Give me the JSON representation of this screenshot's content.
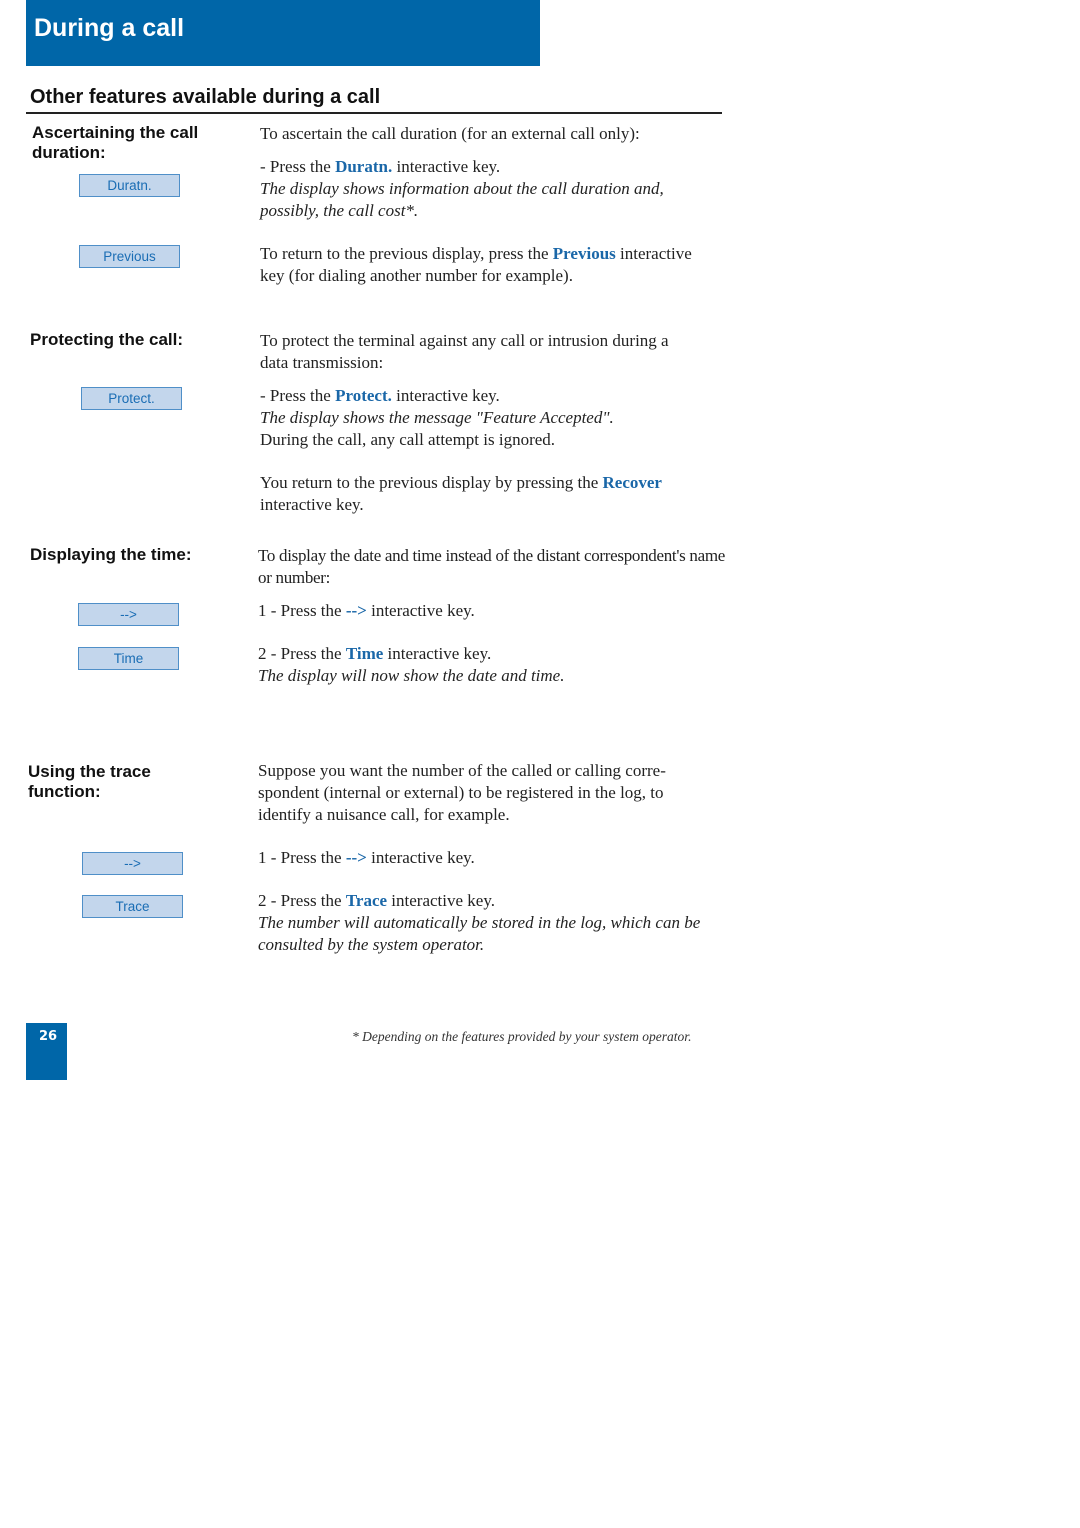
{
  "header": {
    "title": "During a call"
  },
  "section": {
    "title": "Other features available during a call"
  },
  "colors": {
    "brand_blue": "#0066a8",
    "key_fill": "#c3d6ec",
    "key_border": "#4f8fc8",
    "keyword_blue": "#1a67a8"
  },
  "duration": {
    "label": "Ascertaining the call duration:",
    "key_duratn": "Duratn.",
    "key_previous": "Previous",
    "intro": "To ascertain the call duration (for an external call only):",
    "step_pre": "- Press the ",
    "step_kw": "Duratn.",
    "step_post": " interactive key.",
    "note": "The display shows information about the call duration and, possibly, the call cost*.",
    "return_pre": "To return to the previous display, press the ",
    "return_kw": "Previous",
    "return_post": " interactive key (for dialing another number for example)."
  },
  "protect": {
    "label": "Protecting the call:",
    "key": "Protect.",
    "intro": "To protect the terminal against any call or intrusion during a data transmission:",
    "step_pre": "- Press the ",
    "step_kw": "Protect.",
    "step_post": " interactive key.",
    "note": "The display shows the message \"Feature Accepted\".",
    "note2": "During the call, any call attempt is ignored.",
    "return_pre": "You return to the previous display by pressing the ",
    "return_kw": "Recover",
    "return_post": " interactive key."
  },
  "time": {
    "label": "Displaying the time:",
    "key_arrow": "-->",
    "key_time": "Time",
    "intro": "To display the date and time instead of the distant correspondent's name or number:",
    "step1_pre": "1 - Press the ",
    "step1_kw": "-->",
    "step1_post": " interactive key.",
    "step2_pre": "2 - Press the ",
    "step2_kw": "Time",
    "step2_post": " interactive key.",
    "note": "The display will now show the date and time."
  },
  "trace": {
    "label": "Using the trace function:",
    "key_arrow": "-->",
    "key_trace": "Trace",
    "intro": "Suppose you want the number of the called or calling corre-spondent (internal or external) to be registered in the log, to identify a nuisance call, for example.",
    "step1_pre": "1 - Press the ",
    "step1_kw": "-->",
    "step1_post": " interactive key.",
    "step2_pre": "2 - Press the ",
    "step2_kw": "Trace",
    "step2_post": " interactive key.",
    "note": "The number will automatically be stored in the log, which can be consulted by the system operator."
  },
  "footer": {
    "page_number": "26",
    "footnote": "* Depending on the features provided by your system operator."
  }
}
